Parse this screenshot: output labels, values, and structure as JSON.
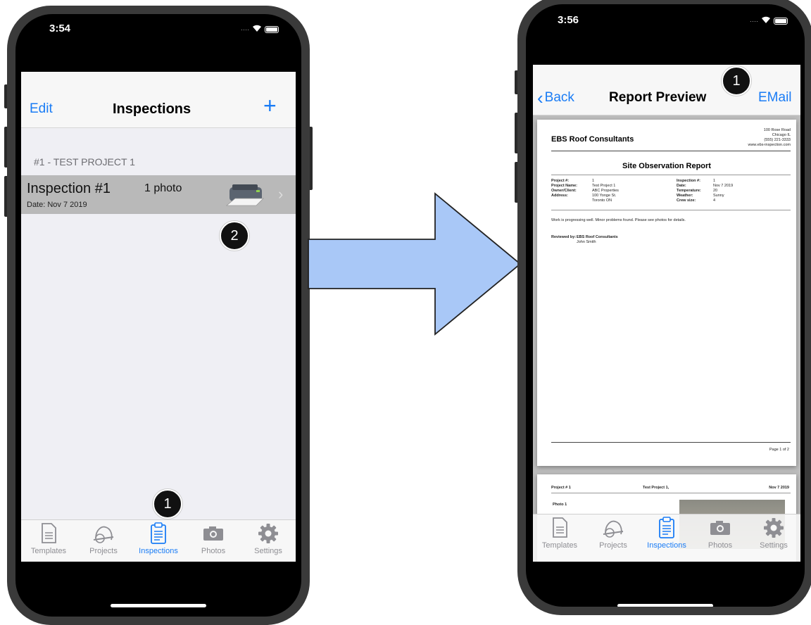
{
  "left_phone": {
    "status_time": "3:54",
    "nav": {
      "edit": "Edit",
      "title": "Inspections",
      "add": "+"
    },
    "section_header": "#1 - TEST PROJECT 1",
    "row": {
      "title": "Inspection #1",
      "photos": "1 photo",
      "date": "Date: Nov 7 2019",
      "chevron": "›"
    },
    "badges": [
      "2",
      "1"
    ],
    "tabs": [
      {
        "label": "Templates",
        "icon": "document-icon"
      },
      {
        "label": "Projects",
        "icon": "hardhat-icon"
      },
      {
        "label": "Inspections",
        "icon": "clipboard-icon",
        "active": true
      },
      {
        "label": "Photos",
        "icon": "camera-icon"
      },
      {
        "label": "Settings",
        "icon": "gear-icon"
      }
    ]
  },
  "right_phone": {
    "status_time": "3:56",
    "nav": {
      "back": "Back",
      "title": "Report Preview",
      "email": "EMail"
    },
    "badge": "1",
    "report": {
      "company": "EBS Roof Consultants",
      "company_address": [
        "100 Rose Road",
        "Chicago IL",
        "(555) 221-3333",
        "www.ebs-inspection.com"
      ],
      "heading": "Site Observation Report",
      "left_fields": [
        {
          "label": "Project #:",
          "value": "1"
        },
        {
          "label": "Project Name:",
          "value": "Test Project 1"
        },
        {
          "label": "Owner/Client:",
          "value": "ABC Properties"
        },
        {
          "label": "Address:",
          "value": "100 Yonge St."
        },
        {
          "label": "",
          "value": "Toronto ON"
        }
      ],
      "right_fields": [
        {
          "label": "Inspection #:",
          "value": "1"
        },
        {
          "label": "Date:",
          "value": "Nov 7 2019"
        },
        {
          "label": "Temperature:",
          "value": "20"
        },
        {
          "label": "Weather:",
          "value": "Sunny"
        },
        {
          "label": "Crew size:",
          "value": "4"
        }
      ],
      "notes": "Work is progressing well.  Minor problems found.  Please see photos for details.",
      "reviewed_label": "Reviewed by:",
      "reviewed_company": "EBS Roof Consultants",
      "reviewed_name": "John Smith",
      "page_footer": "Page 1 of 2",
      "page2_left": "Project # 1",
      "page2_center": "Test Project 1,",
      "page2_right": "Nov 7 2019",
      "page2_photo": "Photo 1"
    },
    "tabs": [
      {
        "label": "Templates",
        "icon": "document-icon"
      },
      {
        "label": "Projects",
        "icon": "hardhat-icon"
      },
      {
        "label": "Inspections",
        "icon": "clipboard-icon",
        "active": true
      },
      {
        "label": "Photos",
        "icon": "camera-icon"
      },
      {
        "label": "Settings",
        "icon": "gear-icon"
      }
    ]
  },
  "colors": {
    "accent": "#1a7cf5",
    "arrow_fill": "#a9c8f7",
    "row_highlight": "#b9b9b9"
  }
}
